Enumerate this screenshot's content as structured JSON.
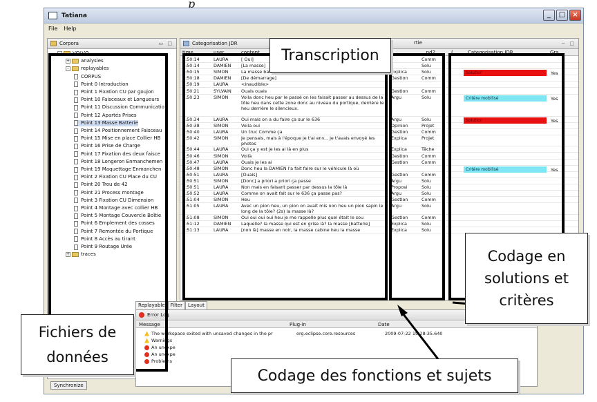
{
  "italic_top": "p",
  "window": {
    "title": "Tatiana",
    "menu": [
      "File",
      "Help"
    ]
  },
  "corpora_panel": {
    "tab_label": "Corpora",
    "tree": [
      {
        "label": "VOLVO",
        "kind": "folder",
        "indent": 0,
        "expander": "-"
      },
      {
        "label": "analysies",
        "kind": "folder",
        "indent": 1,
        "expander": "+"
      },
      {
        "label": "replayables",
        "kind": "folder",
        "indent": 1,
        "expander": "-"
      },
      {
        "label": "CORPUS",
        "kind": "file",
        "indent": 2
      },
      {
        "label": "Point 0 Introduction",
        "kind": "file",
        "indent": 2
      },
      {
        "label": "Point 1 Fixation CU par goujon",
        "kind": "file",
        "indent": 2
      },
      {
        "label": "Point 10 Faisceaux et Longueurs",
        "kind": "file",
        "indent": 2
      },
      {
        "label": "Point 11 Discussion Communicatio",
        "kind": "file",
        "indent": 2
      },
      {
        "label": "Point 12 Apartés Prises",
        "kind": "file",
        "indent": 2
      },
      {
        "label": "Point 13 Masse Batterie",
        "kind": "file",
        "indent": 2,
        "selected": true
      },
      {
        "label": "Point 14 Positionnement Faisceau",
        "kind": "file",
        "indent": 2
      },
      {
        "label": "Point 15 Mise en place Collier HB",
        "kind": "file",
        "indent": 2
      },
      {
        "label": "Point 16 Prise de Charge",
        "kind": "file",
        "indent": 2
      },
      {
        "label": "Point 17 Fixation des deux faisce",
        "kind": "file",
        "indent": 2
      },
      {
        "label": "Point 18 Longeron Enmanchemen",
        "kind": "file",
        "indent": 2
      },
      {
        "label": "Point 19 Maquettage Enmanchen",
        "kind": "file",
        "indent": 2
      },
      {
        "label": "Point 2 Fixation CU Place du CU",
        "kind": "file",
        "indent": 2
      },
      {
        "label": "Point 20 Trou de 42",
        "kind": "file",
        "indent": 2
      },
      {
        "label": "Point 21 Process montage",
        "kind": "file",
        "indent": 2
      },
      {
        "label": "Point 3 Fixation CU Dimension",
        "kind": "file",
        "indent": 2
      },
      {
        "label": "Point 4 Montage avec collier HB",
        "kind": "file",
        "indent": 2
      },
      {
        "label": "Point 5 Montage Couvercle Boîtie",
        "kind": "file",
        "indent": 2
      },
      {
        "label": "Point 6 Emplement des cosses",
        "kind": "file",
        "indent": 2
      },
      {
        "label": "Point 7 Remontée du Portique",
        "kind": "file",
        "indent": 2
      },
      {
        "label": "Point 8 Accès au tirant",
        "kind": "file",
        "indent": 2
      },
      {
        "label": "Point 9 Routage Urée",
        "kind": "file",
        "indent": 2
      },
      {
        "label": "traces",
        "kind": "folder",
        "indent": 1,
        "expander": "+"
      }
    ],
    "sync_button": "Synchronize"
  },
  "editor": {
    "tab_label": "Categorisation JDR",
    "tab2_label": "rtie",
    "columns": {
      "time": "time",
      "user": "user",
      "content": "content",
      "col4": "",
      "col5": "...nd2"
    },
    "rows": [
      {
        "time": "0:50:14",
        "user": "LAURA",
        "content": "[ Oui]",
        "c4": "",
        "c5": "Comm"
      },
      {
        "time": "0:50:14",
        "user": "DAMIEN",
        "content": "[La masse]",
        "c4": "",
        "c5": "Solu"
      },
      {
        "time": "0:50:15",
        "user": "SIMON",
        "content": "La masse batterie et puis la masse [de démarrage]",
        "c4": "Explica",
        "c5": "Solu"
      },
      {
        "time": "0:50:18",
        "user": "DAMIEN",
        "content": "[De démarrage]",
        "c4": "Gestion",
        "c5": "Comm"
      },
      {
        "time": "0:50:19",
        "user": "LAURA",
        "content": "<inaudible>",
        "c4": "",
        "c5": ""
      },
      {
        "time": "0:50:21",
        "user": "SYLVAIN",
        "content": "Ouais ouais",
        "c4": "Gestion",
        "c5": "Comm"
      },
      {
        "time": "0:50:23",
        "user": "SIMON",
        "content": "Voila donc heu par le passé on les faisait passer au dessus de la tôle heu dans cette zone donc au niveau du portique, derrière le heu derrière le silencieux.",
        "c4": "Argu",
        "c5": "Solu",
        "h": "tall"
      },
      {
        "time": "0:50:34",
        "user": "LAURA",
        "content": "Oui mais on a du faire ça sur le 636",
        "c4": "Argu",
        "c5": "Solu"
      },
      {
        "time": "0:50:38",
        "user": "SIMON",
        "content": "Voila oui",
        "c4": "Opinion",
        "c5": "Projet"
      },
      {
        "time": "0:50:40",
        "user": "LAURA",
        "content": "Un truc Comme ça",
        "c4": "Gestion",
        "c5": "Comm"
      },
      {
        "time": "0:50:42",
        "user": "SIMON",
        "content": "Je pensais, mais à l'époque je t'ai env... je t'avais envoyé les photos",
        "c4": "Explica",
        "c5": "Projet",
        "h": "mid"
      },
      {
        "time": "0:50:44",
        "user": "LAURA",
        "content": "Oui ça y est je les ai là en plus",
        "c4": "Explica",
        "c5": "Tâche"
      },
      {
        "time": "0:50:46",
        "user": "SIMON",
        "content": "Voilà",
        "c4": "Gestion",
        "c5": "Comm"
      },
      {
        "time": "0:50:47",
        "user": "LAURA",
        "content": "Ouais je les ai",
        "c4": "Gestion",
        "c5": "Comm"
      },
      {
        "time": "0:50:48",
        "user": "SIMON",
        "content": "Donc heu la DAMIEN l'a fait faire sur le véhicule là où",
        "c4": "",
        "c5": ""
      },
      {
        "time": "0:50:51",
        "user": "LAURA",
        "content": "[Ouais]",
        "c4": "Gestion",
        "c5": "Comm"
      },
      {
        "time": "0:50:51",
        "user": "SIMON",
        "content": "[Donc] a priori a priori ça passe",
        "c4": "Argu",
        "c5": "Solu"
      },
      {
        "time": "0:50:51",
        "user": "LAURA",
        "content": "Non mais en faisant passer par dessus la tôle là",
        "c4": "Proposi",
        "c5": "Solu"
      },
      {
        "time": "0:50:52",
        "user": "LAURA",
        "content": "Comme on avait fait sur le 636 ça passe pas?",
        "c4": "Argu",
        "c5": "Solu"
      },
      {
        "time": "0:51:04",
        "user": "SIMON",
        "content": "Heu",
        "c4": "Gestion",
        "c5": "Comm"
      },
      {
        "time": "0:51:05",
        "user": "LAURA",
        "content": "Avec un pion heu, un pion on avait mis non heu un pion sapin le long de la tôle? (2s) la masse là?",
        "c4": "Argu",
        "c5": "Solu",
        "h": "mid"
      },
      {
        "time": "0:51:08",
        "user": "SIMON",
        "content": "Oui oui oui oui heu je me rappelle plus quel était le sou",
        "c4": "Gestion",
        "c5": "Comm"
      },
      {
        "time": "0:51:12",
        "user": "DAMIEN",
        "content": "Laquelle? la masse qui est en grise là? la masse [batterie]",
        "c4": "Explica",
        "c5": "Solu"
      },
      {
        "time": "0:51:13",
        "user": "LAURA",
        "content": "[non là] masse en noir, la masse cabine heu la masse",
        "c4": "Explica",
        "c5": "Solu"
      }
    ],
    "coding_cols": {
      "c1": "(...",
      "c2": "Categorisation JDR",
      "c3": "Gra..."
    },
    "coding": [
      {
        "row": 2,
        "label": "Solution",
        "color": "#e81010",
        "yes": "Yes"
      },
      {
        "row": 6,
        "label": "Critère mobilisé",
        "color": "#7fe6f4",
        "yes": "Yes"
      },
      {
        "row": 7,
        "label": "Solution",
        "color": "#e81010",
        "yes": "Yes"
      },
      {
        "row": 14,
        "label": "Critère mobilisé",
        "color": "#7fe6f4",
        "yes": "Yes"
      }
    ]
  },
  "bottom_tabs": [
    "Replayable",
    "Filter",
    "Layout"
  ],
  "error_log": {
    "tab_label": "Error Log",
    "columns": {
      "message": "Message",
      "plugin": "Plug-in",
      "date": "Date"
    },
    "entries": [
      {
        "kind": "warn",
        "message": "The workspace exited with unsaved changes in the pr",
        "plugin": "org.eclipse.core.resources",
        "date": "2009-07-22 19:28:35.640"
      },
      {
        "kind": "warn",
        "message": "Warnings",
        "plugin": "",
        "date": ""
      },
      {
        "kind": "err",
        "message": "An unexpe",
        "plugin": "",
        "date": ""
      },
      {
        "kind": "err",
        "message": "An unexpe",
        "plugin": "",
        "date": ""
      },
      {
        "kind": "err",
        "message": "Problems",
        "plugin": "",
        "date": ""
      }
    ]
  },
  "annotations": {
    "transcription": "Transcription",
    "codage_solutions": [
      "Codage en",
      "solutions et",
      "critères"
    ],
    "fichiers": [
      "Fichiers de",
      "données"
    ],
    "codage_fonctions": "Codage des fonctions et sujets"
  }
}
